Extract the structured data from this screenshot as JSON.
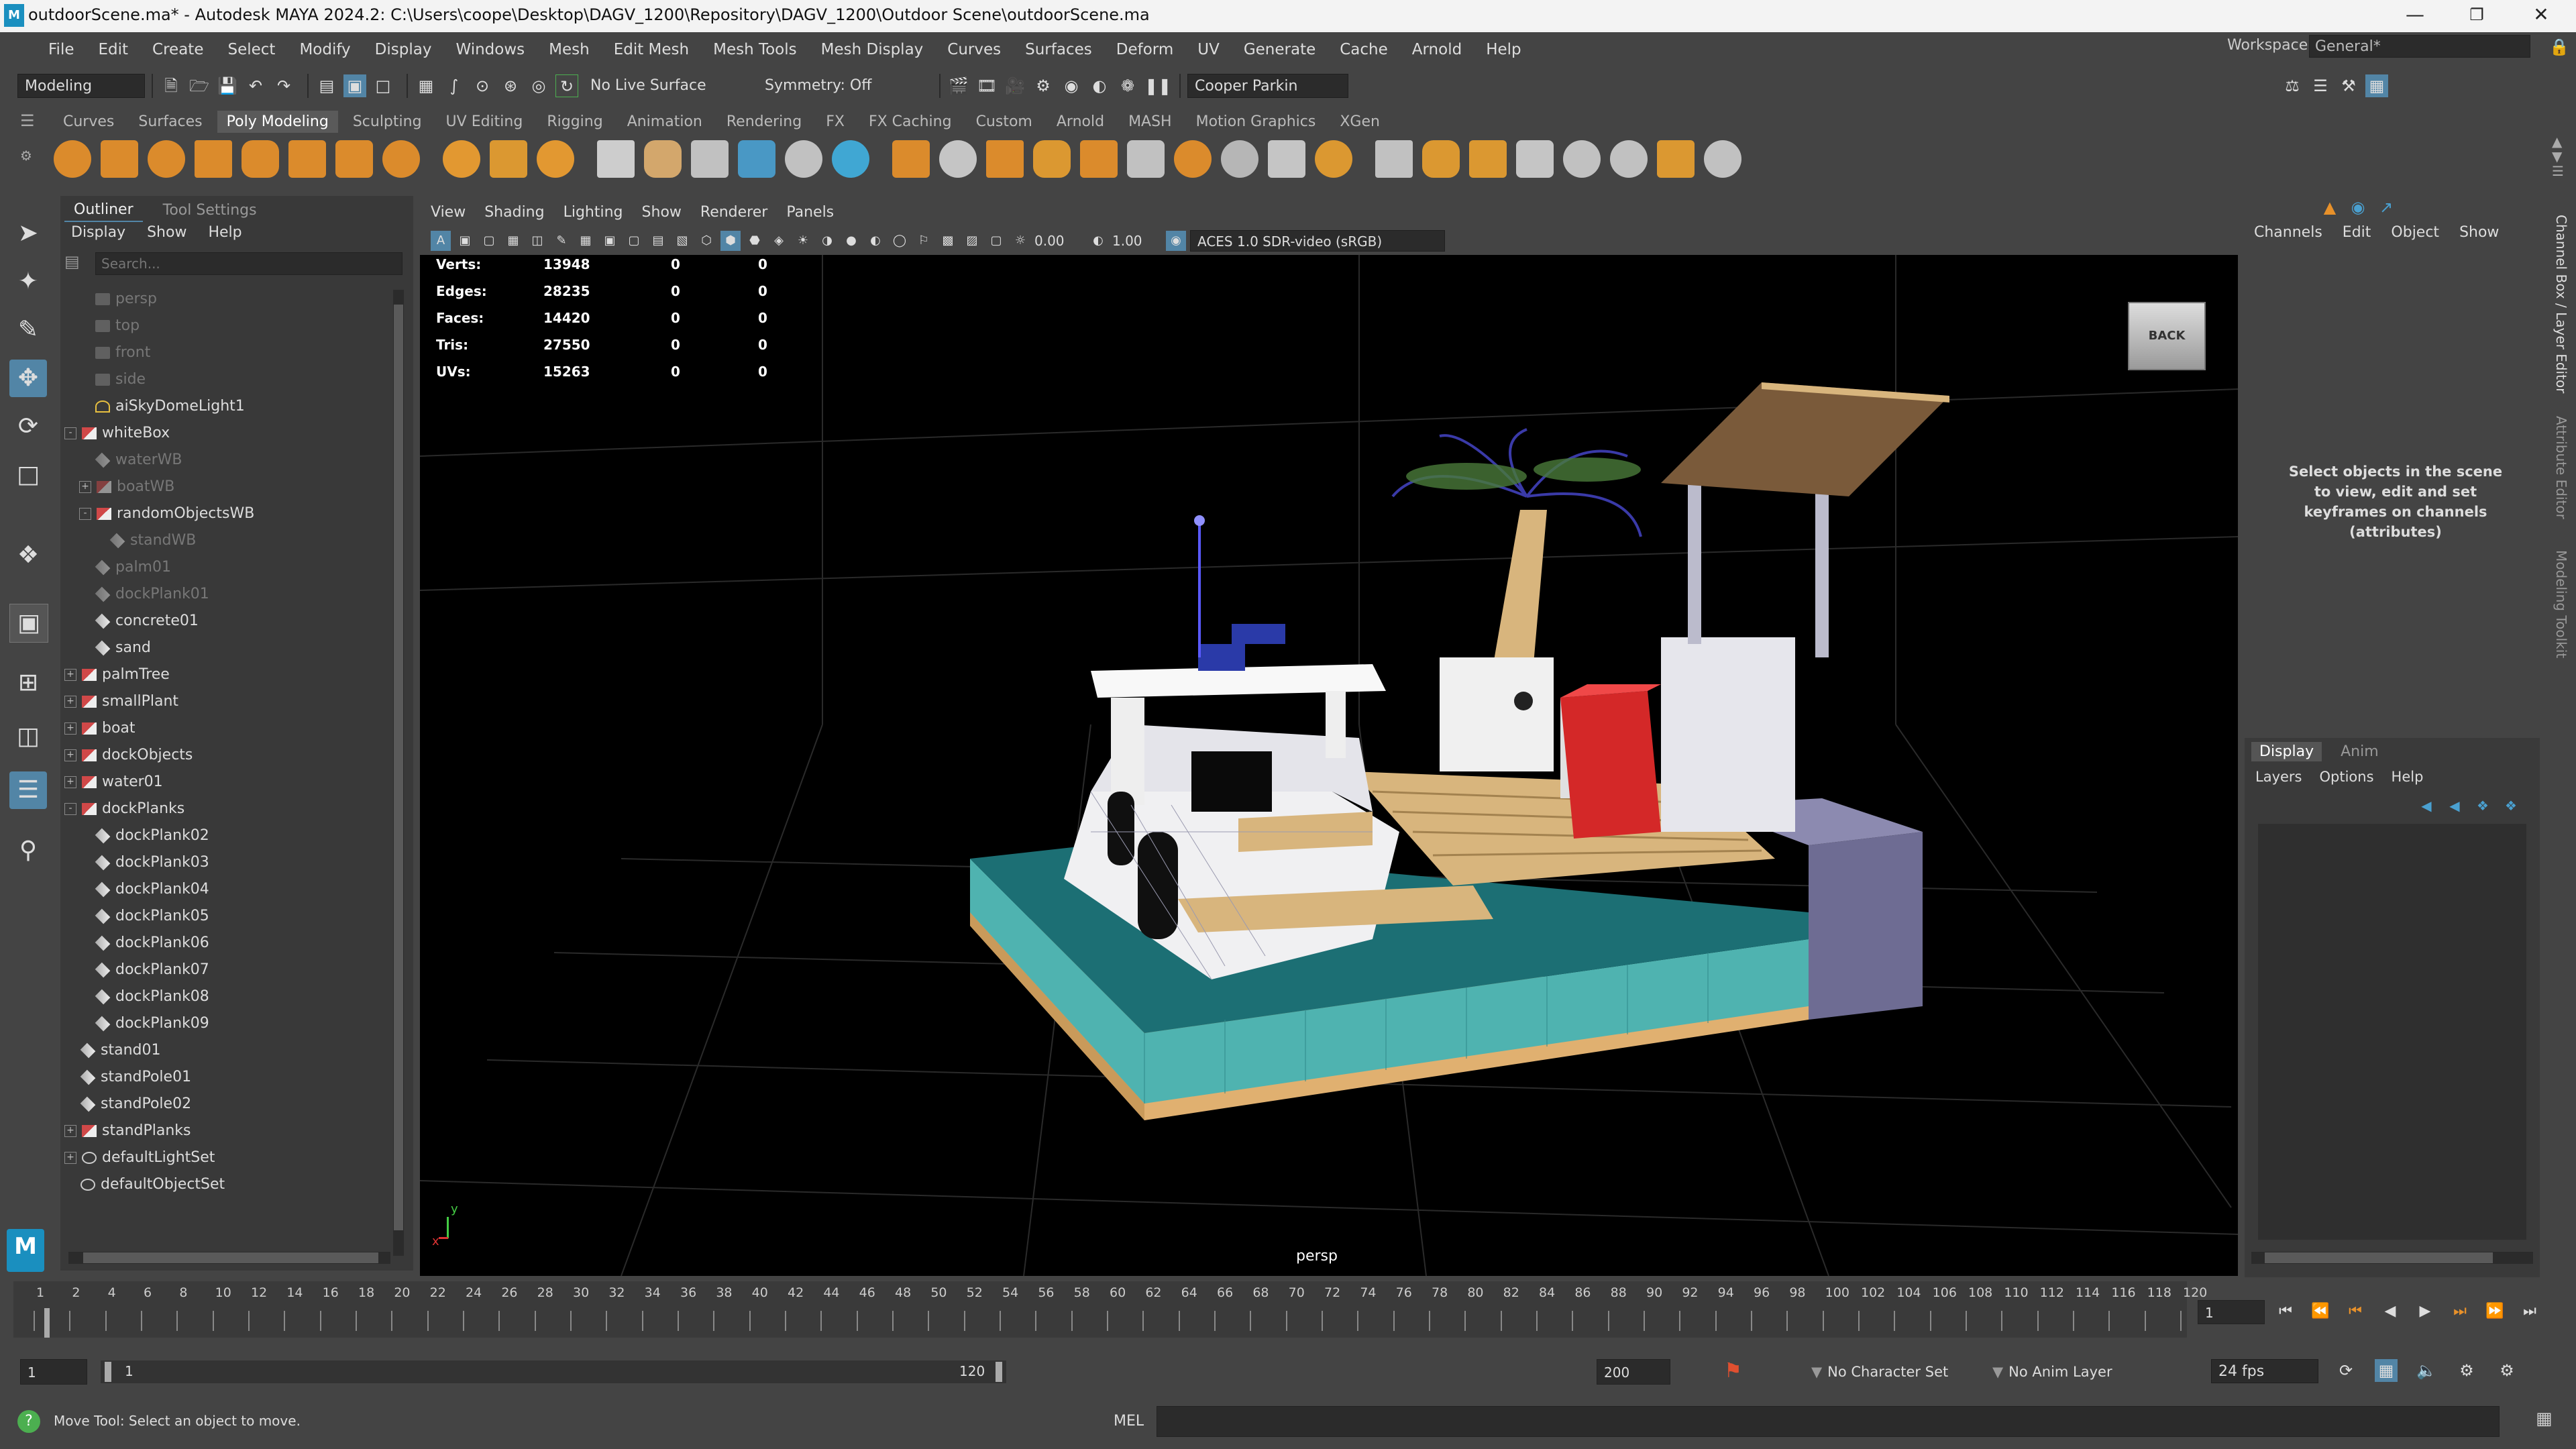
{
  "window": {
    "title": "outdoorScene.ma* - Autodesk MAYA 2024.2: C:\\Users\\coope\\Desktop\\DAGV_1200\\Repository\\DAGV_1200\\Outdoor Scene\\outdoorScene.ma"
  },
  "menubar": {
    "items": [
      "File",
      "Edit",
      "Create",
      "Select",
      "Modify",
      "Display",
      "Windows",
      "Mesh",
      "Edit Mesh",
      "Mesh Tools",
      "Mesh Display",
      "Curves",
      "Surfaces",
      "Deform",
      "UV",
      "Generate",
      "Cache",
      "Arnold",
      "Help"
    ],
    "workspace_label": "Workspace:",
    "workspace_value": "General*"
  },
  "statusline": {
    "mode": "Modeling",
    "live_surface": "No Live Surface",
    "symmetry": "Symmetry: Off",
    "user": "Cooper Parkin"
  },
  "shelf": {
    "tabs": [
      "Curves",
      "Surfaces",
      "Poly Modeling",
      "Sculpting",
      "UV Editing",
      "Rigging",
      "Animation",
      "Rendering",
      "FX",
      "FX Caching",
      "Custom",
      "Arnold",
      "MASH",
      "Motion Graphics",
      "XGen"
    ],
    "active": "Poly Modeling",
    "icon_colors": [
      "#e8912a",
      "#e8912a",
      "#e8912a",
      "#e8912a",
      "#e8912a",
      "#e8912a",
      "#e8912a",
      "#e8912a",
      "#f0a030",
      "#e8a030",
      "#f0a030",
      "#d9d9d9",
      "#e0b070",
      "#cccccc",
      "#4aa0d0",
      "#cccccc",
      "#40b0e0",
      "#e8912a",
      "#d0d0d0",
      "#e8912a",
      "#e8a030",
      "#e8912a",
      "#cccccc",
      "#e8912a",
      "#c0c0c0",
      "#d0d0d0",
      "#e8a030",
      "#cccccc",
      "#e8a030",
      "#e8a030",
      "#d0d0d0",
      "#cccccc",
      "#cccccc",
      "#e8a030",
      "#cccccc"
    ]
  },
  "outliner": {
    "tabs": [
      "Outliner",
      "Tool Settings"
    ],
    "menu": [
      "Display",
      "Show",
      "Help"
    ],
    "search_placeholder": "Search...",
    "items": [
      {
        "label": "persp",
        "dim": true,
        "indent": 1,
        "expand": "",
        "type": "camera"
      },
      {
        "label": "top",
        "dim": true,
        "indent": 1,
        "expand": "",
        "type": "camera"
      },
      {
        "label": "front",
        "dim": true,
        "indent": 1,
        "expand": "",
        "type": "camera"
      },
      {
        "label": "side",
        "dim": true,
        "indent": 1,
        "expand": "",
        "type": "camera"
      },
      {
        "label": "aiSkyDomeLight1",
        "dim": false,
        "indent": 1,
        "expand": "",
        "type": "light"
      },
      {
        "label": "whiteBox",
        "dim": false,
        "indent": 0,
        "expand": "-",
        "type": "group"
      },
      {
        "label": "waterWB",
        "dim": true,
        "indent": 1,
        "expand": "",
        "type": "mesh"
      },
      {
        "label": "boatWB",
        "dim": true,
        "indent": 1,
        "expand": "+",
        "type": "group"
      },
      {
        "label": "randomObjectsWB",
        "dim": false,
        "indent": 1,
        "expand": "-",
        "type": "group"
      },
      {
        "label": "standWB",
        "dim": true,
        "indent": 2,
        "expand": "",
        "type": "mesh"
      },
      {
        "label": "palm01",
        "dim": true,
        "indent": 1,
        "expand": "",
        "type": "mesh"
      },
      {
        "label": "dockPlank01",
        "dim": true,
        "indent": 1,
        "expand": "",
        "type": "mesh"
      },
      {
        "label": "concrete01",
        "dim": false,
        "indent": 1,
        "expand": "",
        "type": "mesh"
      },
      {
        "label": "sand",
        "dim": false,
        "indent": 1,
        "expand": "",
        "type": "mesh"
      },
      {
        "label": "palmTree",
        "dim": false,
        "indent": 0,
        "expand": "+",
        "type": "group"
      },
      {
        "label": "smallPlant",
        "dim": false,
        "indent": 0,
        "expand": "+",
        "type": "group"
      },
      {
        "label": "boat",
        "dim": false,
        "indent": 0,
        "expand": "+",
        "type": "group"
      },
      {
        "label": "dockObjects",
        "dim": false,
        "indent": 0,
        "expand": "+",
        "type": "group"
      },
      {
        "label": "water01",
        "dim": false,
        "indent": 0,
        "expand": "+",
        "type": "group"
      },
      {
        "label": "dockPlanks",
        "dim": false,
        "indent": 0,
        "expand": "-",
        "type": "group"
      },
      {
        "label": "dockPlank02",
        "dim": false,
        "indent": 1,
        "expand": "",
        "type": "mesh"
      },
      {
        "label": "dockPlank03",
        "dim": false,
        "indent": 1,
        "expand": "",
        "type": "mesh"
      },
      {
        "label": "dockPlank04",
        "dim": false,
        "indent": 1,
        "expand": "",
        "type": "mesh"
      },
      {
        "label": "dockPlank05",
        "dim": false,
        "indent": 1,
        "expand": "",
        "type": "mesh"
      },
      {
        "label": "dockPlank06",
        "dim": false,
        "indent": 1,
        "expand": "",
        "type": "mesh"
      },
      {
        "label": "dockPlank07",
        "dim": false,
        "indent": 1,
        "expand": "",
        "type": "mesh"
      },
      {
        "label": "dockPlank08",
        "dim": false,
        "indent": 1,
        "expand": "",
        "type": "mesh"
      },
      {
        "label": "dockPlank09",
        "dim": false,
        "indent": 1,
        "expand": "",
        "type": "mesh"
      },
      {
        "label": "stand01",
        "dim": false,
        "indent": 0,
        "expand": "",
        "type": "mesh"
      },
      {
        "label": "standPole01",
        "dim": false,
        "indent": 0,
        "expand": "",
        "type": "mesh"
      },
      {
        "label": "standPole02",
        "dim": false,
        "indent": 0,
        "expand": "",
        "type": "mesh"
      },
      {
        "label": "standPlanks",
        "dim": false,
        "indent": 0,
        "expand": "+",
        "type": "group"
      },
      {
        "label": "defaultLightSet",
        "dim": false,
        "indent": 0,
        "expand": "+",
        "type": "set"
      },
      {
        "label": "defaultObjectSet",
        "dim": false,
        "indent": 0,
        "expand": "",
        "type": "set"
      }
    ]
  },
  "viewport": {
    "menu": [
      "View",
      "Shading",
      "Lighting",
      "Show",
      "Renderer",
      "Panels"
    ],
    "exposure": "0.00",
    "gamma": "1.00",
    "color_space": "ACES 1.0 SDR-video (sRGB)",
    "camera_label": "persp",
    "viewcube": "BACK",
    "axis_y": "y",
    "axis_x": "x",
    "hud": [
      {
        "label": "Verts:",
        "v1": "13948",
        "v2": "0",
        "v3": "0"
      },
      {
        "label": "Edges:",
        "v1": "28235",
        "v2": "0",
        "v3": "0"
      },
      {
        "label": "Faces:",
        "v1": "14420",
        "v2": "0",
        "v3": "0"
      },
      {
        "label": "Tris:",
        "v1": "27550",
        "v2": "0",
        "v3": "0"
      },
      {
        "label": "UVs:",
        "v1": "15263",
        "v2": "0",
        "v3": "0"
      }
    ]
  },
  "channelbox": {
    "menu": [
      "Channels",
      "Edit",
      "Object",
      "Show"
    ],
    "message": "Select objects in the scene to view, edit and set keyframes on channels (attributes)",
    "layer_tabs": [
      "Display",
      "Anim"
    ],
    "layer_menu": [
      "Layers",
      "Options",
      "Help"
    ]
  },
  "sidetabs": [
    "Channel Box / Layer Editor",
    "Attribute Editor",
    "Modeling Toolkit"
  ],
  "timeline": {
    "ticks": [
      "1",
      "2",
      "4",
      "6",
      "8",
      "10",
      "12",
      "14",
      "16",
      "18",
      "20",
      "22",
      "24",
      "26",
      "28",
      "30",
      "32",
      "34",
      "36",
      "38",
      "40",
      "42",
      "44",
      "46",
      "48",
      "50",
      "52",
      "54",
      "56",
      "58",
      "60",
      "62",
      "64",
      "66",
      "68",
      "70",
      "72",
      "74",
      "76",
      "78",
      "80",
      "82",
      "84",
      "86",
      "88",
      "90",
      "92",
      "94",
      "96",
      "98",
      "100",
      "102",
      "104",
      "106",
      "108",
      "110",
      "112",
      "114",
      "116",
      "118",
      "120"
    ],
    "current_frame": "1"
  },
  "range": {
    "start": "1",
    "inner_start": "1",
    "inner_end": "120",
    "end": "200",
    "character_set": "No Character Set",
    "anim_layer": "No Anim Layer",
    "fps": "24 fps"
  },
  "cmdline": {
    "help": "Move Tool: Select an object to move.",
    "lang": "MEL"
  }
}
